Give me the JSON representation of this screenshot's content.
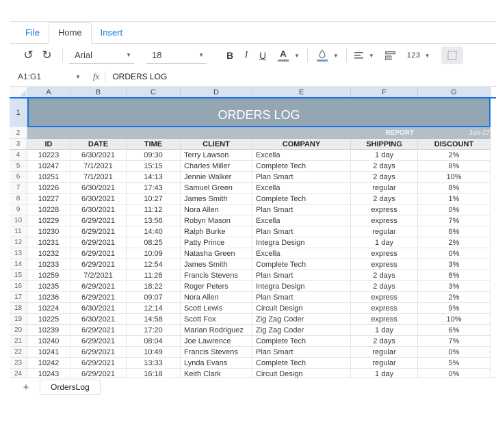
{
  "menu": {
    "file": "File",
    "home": "Home",
    "insert": "Insert"
  },
  "toolbar": {
    "undo": "↺",
    "redo": "↻",
    "font_name": "Arial",
    "font_size": "18",
    "bold": "B",
    "italic": "I",
    "underline": "U",
    "text_color": "A",
    "number_format": "123"
  },
  "formula_bar": {
    "cell_reference": "A1:G1",
    "fx_label": "fx",
    "formula_value": "ORDERS LOG"
  },
  "grid": {
    "column_letters": [
      "A",
      "B",
      "C",
      "D",
      "E",
      "F",
      "G"
    ],
    "row_numbers": {
      "title_row": "1",
      "band_row": "2",
      "header_row": "3",
      "data_start": 4
    },
    "title": "ORDERS LOG",
    "report_label": "REPORT",
    "report_date": "Jun-27",
    "headers": [
      "ID",
      "DATE",
      "TIME",
      "CLIENT",
      "COMPANY",
      "SHIPPING",
      "DISCOUNT"
    ],
    "rows": [
      [
        "10223",
        "6/30/2021",
        "09:30",
        "Terry Lawson",
        "Excella",
        "1 day",
        "2%"
      ],
      [
        "10247",
        "7/1/2021",
        "15:15",
        "Charles Miller",
        "Complete Tech",
        "2 days",
        "8%"
      ],
      [
        "10251",
        "7/1/2021",
        "14:13",
        "Jennie Walker",
        "Plan Smart",
        "2 days",
        "10%"
      ],
      [
        "10226",
        "6/30/2021",
        "17:43",
        "Samuel Green",
        "Excella",
        "regular",
        "8%"
      ],
      [
        "10227",
        "6/30/2021",
        "10:27",
        "James Smith",
        "Complete Tech",
        "2 days",
        "1%"
      ],
      [
        "10228",
        "6/30/2021",
        "11:12",
        "Nora Allen",
        "Plan Smart",
        "express",
        "0%"
      ],
      [
        "10229",
        "6/29/2021",
        "13:56",
        "Robyn Mason",
        "Excella",
        "express",
        "7%"
      ],
      [
        "10230",
        "6/29/2021",
        "14:40",
        "Ralph Burke",
        "Plan Smart",
        "regular",
        "6%"
      ],
      [
        "10231",
        "6/29/2021",
        "08:25",
        "Patty Prince",
        "Integra Design",
        "1 day",
        "2%"
      ],
      [
        "10232",
        "6/29/2021",
        "10:09",
        "Natasha Green",
        "Excella",
        "express",
        "0%"
      ],
      [
        "10233",
        "6/29/2021",
        "12:54",
        "James Smith",
        "Complete Tech",
        "express",
        "3%"
      ],
      [
        "10259",
        "7/2/2021",
        "11:28",
        "Francis Stevens",
        "Plan Smart",
        "2 days",
        "8%"
      ],
      [
        "10235",
        "6/29/2021",
        "18:22",
        "Roger Peters",
        "Integra Design",
        "2 days",
        "3%"
      ],
      [
        "10236",
        "6/29/2021",
        "09:07",
        "Nora Allen",
        "Plan Smart",
        "express",
        "2%"
      ],
      [
        "10224",
        "6/30/2021",
        "12:14",
        "Scott Lewis",
        "Circuit Design",
        "express",
        "9%"
      ],
      [
        "10225",
        "6/30/2021",
        "14:58",
        "Scott Fox",
        "Zig Zag Coder",
        "express",
        "10%"
      ],
      [
        "10239",
        "6/29/2021",
        "17:20",
        "Marian Rodriguez",
        "Zig Zag Coder",
        "1 day",
        "6%"
      ],
      [
        "10240",
        "6/29/2021",
        "08:04",
        "Joe Lawrence",
        "Complete Tech",
        "2 days",
        "7%"
      ],
      [
        "10241",
        "6/29/2021",
        "10:49",
        "Francis Stevens",
        "Plan Smart",
        "regular",
        "0%"
      ],
      [
        "10242",
        "6/29/2021",
        "13:33",
        "Lynda Evans",
        "Complete Tech",
        "regular",
        "5%"
      ],
      [
        "10243",
        "6/29/2021",
        "16:18",
        "Keith Clark",
        "Circuit Design",
        "1 day",
        "0%"
      ]
    ]
  },
  "sheet_bar": {
    "add_label": "+",
    "sheet_name": "OrdersLog"
  },
  "colors": {
    "accent_blue": "#1a73e8",
    "title_fill": "#94a5b3",
    "band_fill": "#b4bec6",
    "header_fill": "#eaecee",
    "selected_header_fill": "#d7e3f0"
  }
}
